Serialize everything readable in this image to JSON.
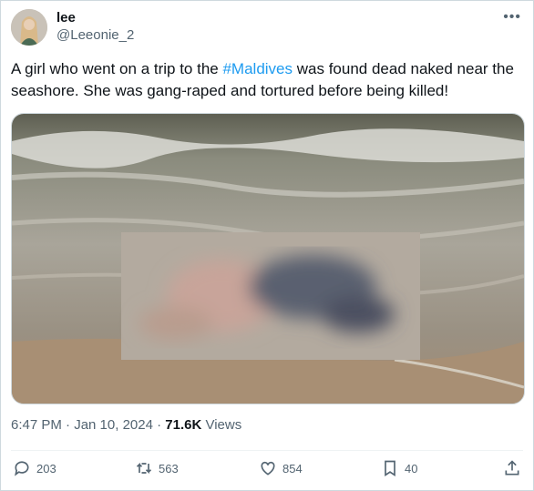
{
  "author": {
    "display_name": "lee",
    "handle": "@Leeonie_2"
  },
  "more_icon": "more-horizontal-icon",
  "tweet": {
    "text_before": "A girl who went on a trip  to the ",
    "hashtag": "#Maldives",
    "text_after": " was found dead naked near the seashore. She was gang-raped and tortured before being killed!"
  },
  "timestamp": {
    "time_date": "6:47 PM · Jan 10, 2024",
    "views_count": "71.6K",
    "views_label": "Views"
  },
  "actions": {
    "replies": "203",
    "retweets": "563",
    "likes": "854",
    "bookmarks": "40"
  },
  "colors": {
    "link": "#1d9bf0",
    "secondary": "#536471",
    "border": "#cfd9de"
  }
}
